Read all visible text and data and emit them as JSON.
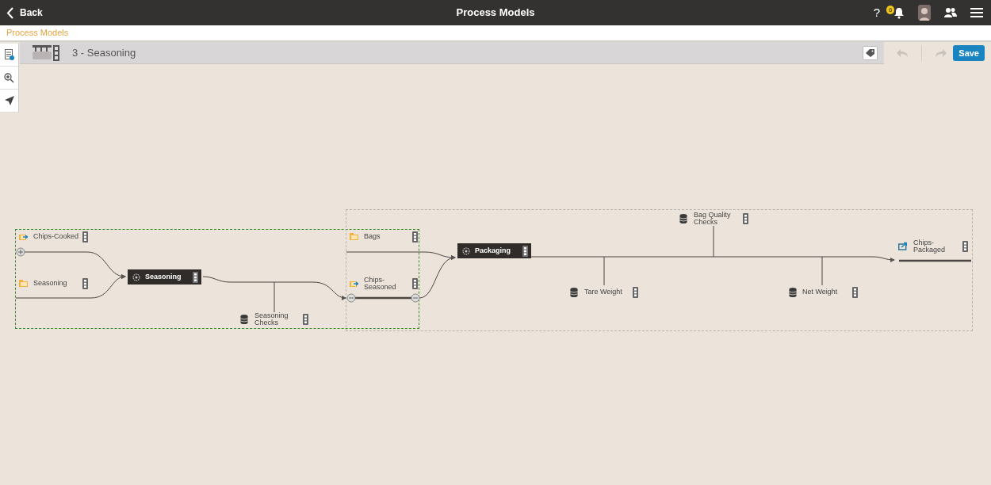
{
  "app_bar": {
    "back": "Back",
    "title": "Process Models",
    "help": "?",
    "notifications": "6"
  },
  "breadcrumb": "Process Models",
  "model": {
    "title": "3 - Seasoning"
  },
  "toolbar": {
    "undo_disabled": true,
    "redo_disabled": true,
    "save": "Save"
  },
  "nodes": [
    {
      "kind": "intermediate",
      "label": "Chips-Cooked"
    },
    {
      "kind": "material",
      "label": "Seasoning"
    },
    {
      "kind": "process",
      "label": "Seasoning"
    },
    {
      "kind": "data",
      "label": "Seasoning Checks"
    },
    {
      "kind": "material",
      "label": "Bags"
    },
    {
      "kind": "intermediate",
      "label": "Chips-Seasoned"
    },
    {
      "kind": "process",
      "label": "Packaging"
    },
    {
      "kind": "data",
      "label": "Tare Weight"
    },
    {
      "kind": "data",
      "label": "Bag Quality Checks"
    },
    {
      "kind": "data",
      "label": "Net Weight"
    },
    {
      "kind": "product",
      "label": "Chips-Packaged"
    }
  ]
}
